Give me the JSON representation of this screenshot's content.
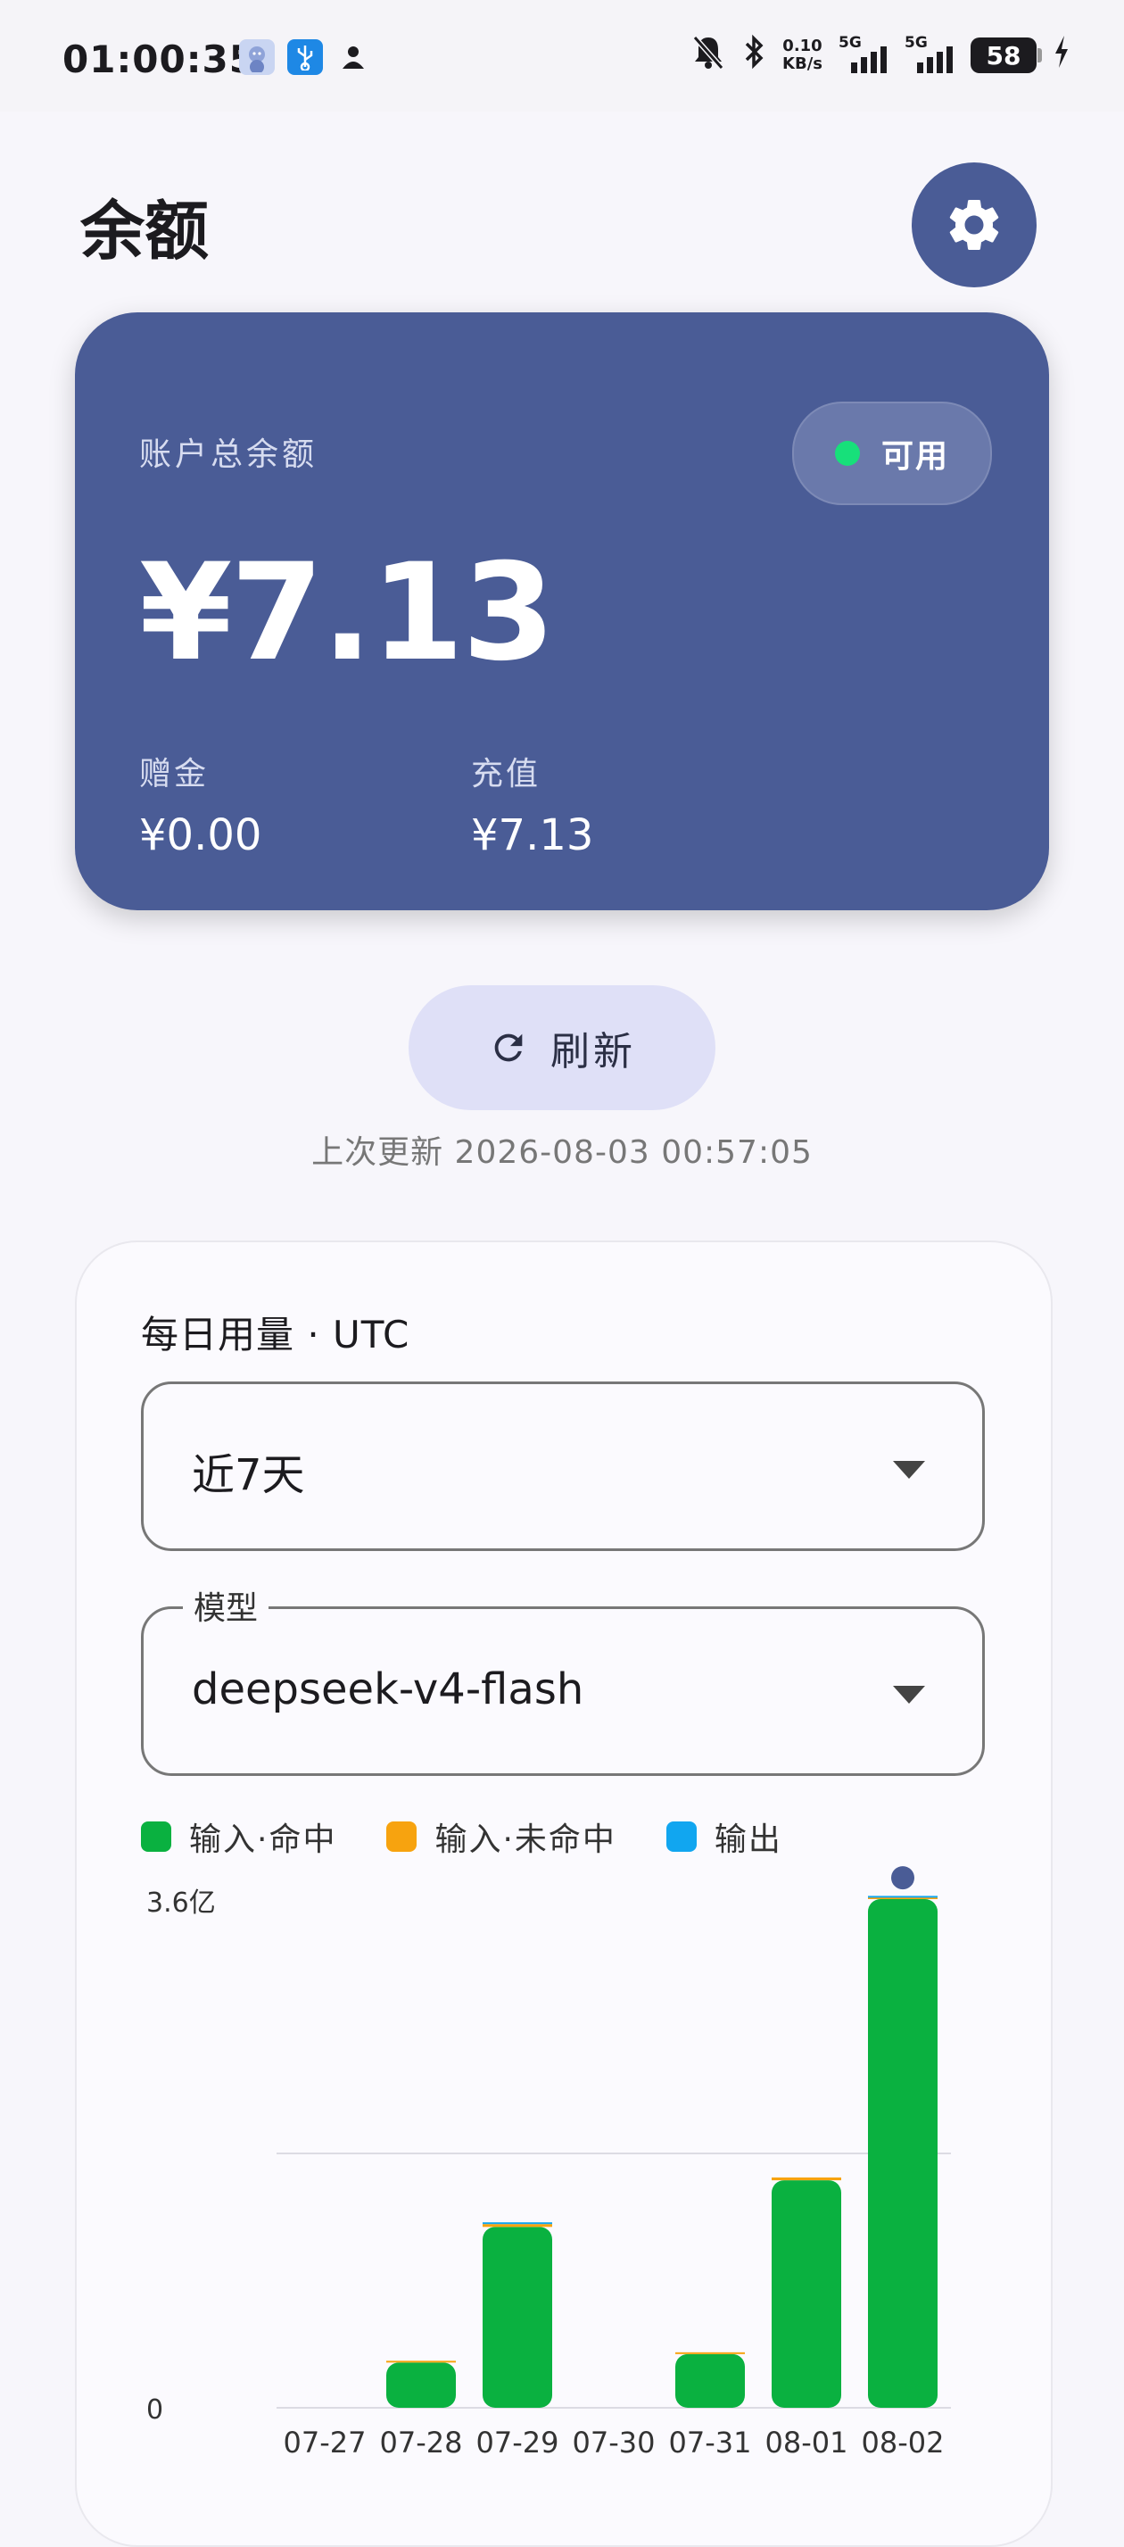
{
  "status_bar": {
    "time": "01:00:35",
    "net_speed_value": "0.10",
    "net_speed_unit": "KB/s",
    "signal1_label": "5G",
    "signal2_label": "5G",
    "battery": "58",
    "left_icons": [
      "anime-avatar-icon",
      "usb-icon",
      "person-icon"
    ],
    "right_icons": [
      "bell-off-icon",
      "bluetooth-icon",
      "charging-icon"
    ]
  },
  "header": {
    "title": "余额"
  },
  "balance": {
    "label": "账户总余额",
    "status": "可用",
    "status_color": "#17e07a",
    "total": "¥7.13",
    "bonus_label": "赠金",
    "bonus_value": "¥0.00",
    "topup_label": "充值",
    "topup_value": "¥7.13",
    "card_color": "#4a5c96"
  },
  "refresh": {
    "label": "刷新",
    "last_update": "上次更新 2026-08-03 00:57:05"
  },
  "usage": {
    "title": "每日用量 · UTC",
    "range_value": "近7天",
    "model_label": "模型",
    "model_value": "deepseek-v4-flash",
    "legend": [
      {
        "label": "输入·命中",
        "color": "#0ab140"
      },
      {
        "label": "输入·未命中",
        "color": "#f7a30f"
      },
      {
        "label": "输出",
        "color": "#11a6f0"
      }
    ]
  },
  "chart_data": {
    "type": "bar",
    "stacked": true,
    "categories": [
      "07-27",
      "07-28",
      "07-29",
      "07-30",
      "07-31",
      "08-01",
      "08-02"
    ],
    "series": [
      {
        "name": "输入·命中",
        "color": "#0ab140",
        "values": [
          0,
          0.32,
          1.28,
          0,
          0.38,
          1.61,
          3.6
        ]
      },
      {
        "name": "输入·未命中",
        "color": "#f7a30f",
        "values": [
          0,
          0.005,
          0.02,
          0,
          0.01,
          0.02,
          0.01
        ]
      },
      {
        "name": "输出",
        "color": "#11a6f0",
        "values": [
          0,
          0,
          0.002,
          0,
          0,
          0,
          0.002
        ]
      }
    ],
    "ylim": [
      0,
      3.6
    ],
    "y_tick_labels": [
      "0",
      "3.6亿"
    ],
    "grid": true,
    "highlight_index": 6,
    "highlight_color": "#4a5c96"
  }
}
